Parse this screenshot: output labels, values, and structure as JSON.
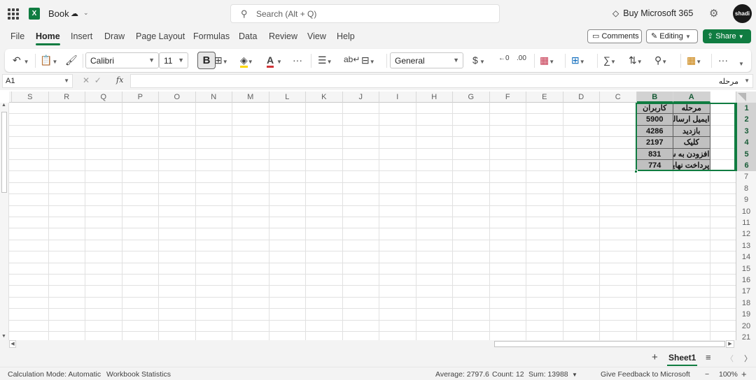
{
  "app": {
    "book_title": "Book",
    "search_placeholder": "Search (Alt + Q)",
    "buy_label": "Buy Microsoft 365",
    "avatar_text": "shadi"
  },
  "menu": {
    "tabs": [
      "File",
      "Home",
      "Insert",
      "Draw",
      "Page Layout",
      "Formulas",
      "Data",
      "Review",
      "View",
      "Help"
    ],
    "active_tab": "Home",
    "comments_label": "Comments",
    "editing_label": "Editing",
    "share_label": "Share"
  },
  "ribbon": {
    "font_name": "Calibri",
    "font_size": "11",
    "bold_label": "B",
    "number_format": "General",
    "font_color": "#d13438",
    "fill_color": "#ffd700"
  },
  "formula_bar": {
    "name_box": "A1",
    "fx_label": "fx",
    "content": "مرحله"
  },
  "grid": {
    "columns": [
      "S",
      "R",
      "Q",
      "P",
      "O",
      "N",
      "M",
      "L",
      "K",
      "J",
      "I",
      "H",
      "G",
      "F",
      "E",
      "D",
      "C",
      "B",
      "A"
    ],
    "selected_columns": [
      "A",
      "B"
    ],
    "rows": [
      "1",
      "2",
      "3",
      "4",
      "5",
      "6",
      "7",
      "8",
      "9",
      "10",
      "11",
      "12",
      "13",
      "14",
      "15",
      "16",
      "17",
      "18",
      "19",
      "20",
      "21"
    ],
    "selected_rows": [
      "1",
      "2",
      "3",
      "4",
      "5",
      "6"
    ],
    "table": [
      {
        "A": "مرحله",
        "B": "کاربران"
      },
      {
        "A": "ایمیل ارسالی",
        "B": "5900"
      },
      {
        "A": "بازدید",
        "B": "4286"
      },
      {
        "A": "کلیک",
        "B": "2197"
      },
      {
        "A": "افزودن به سبد خرید",
        "B": "831"
      },
      {
        "A": "پرداخت نهایی",
        "B": "774"
      }
    ]
  },
  "sheets": {
    "active": "Sheet1"
  },
  "status": {
    "calc_mode": "Calculation Mode: Automatic",
    "workbook_stats": "Workbook Statistics",
    "average": "Average: 2797.6",
    "count": "Count: 12",
    "sum": "Sum: 13988",
    "feedback": "Give Feedback to Microsoft",
    "zoom_out": "−",
    "zoom": "100%",
    "zoom_in": "+"
  },
  "colors": {
    "accent": "#107c41",
    "selected_cell_fill": "#c0c0c0"
  }
}
